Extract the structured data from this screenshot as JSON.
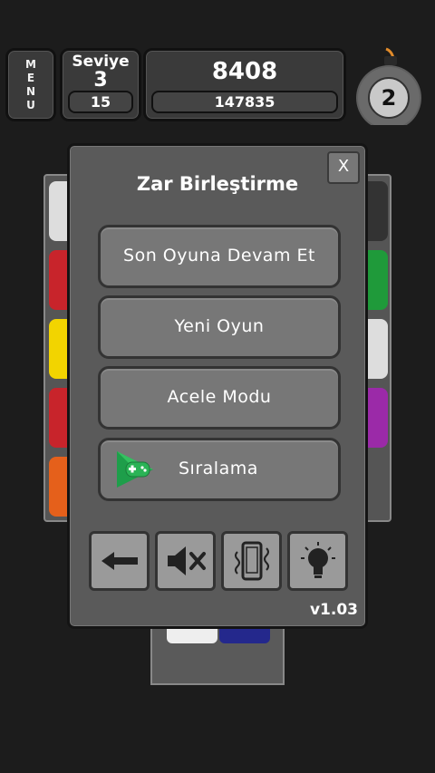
{
  "hud": {
    "menu_label": "MENU",
    "level_label": "Seviye",
    "level_value": "3",
    "level_sub": "15",
    "score": "8408",
    "best_score": "147835",
    "bomb_count": "2"
  },
  "dialog": {
    "title": "Zar Birleştirme",
    "close_label": "X",
    "buttons": {
      "continue": "Son Oyuna Devam Et",
      "new_game": "Yeni Oyun",
      "rush_mode": "Acele Modu",
      "ranking": "Sıralama"
    },
    "tools": [
      "back-arrow-icon",
      "sound-muted-icon",
      "vibrate-icon",
      "lightbulb-icon"
    ],
    "version": "v1.03"
  },
  "colors": {
    "background": "#1c1c1c",
    "panel": "#5a5a5a",
    "button": "#777777",
    "tool_button": "#9a9a9a",
    "dice_red": "#c8242b",
    "dice_green": "#1f9a3a",
    "dice_yellow": "#f2d400",
    "dice_purple": "#9b2aa8",
    "dice_orange": "#e5601b",
    "dice_navy": "#24288c"
  }
}
